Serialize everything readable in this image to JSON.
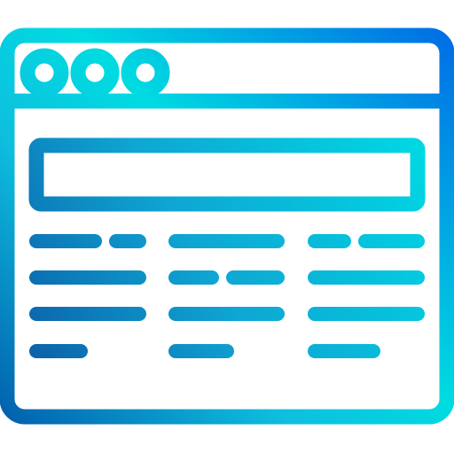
{
  "icon": {
    "name": "browser-window-icon",
    "style": "gradient outline",
    "colors": {
      "gradient_stops": [
        "#00dbe1",
        "#0ebede",
        "#0f89d6",
        "#0054a8"
      ],
      "background": "#ffffff"
    },
    "window_control_dots": 3,
    "address_bar": {
      "present": true
    },
    "content_placeholder_columns": 3,
    "content_placeholder_rows": 4
  }
}
